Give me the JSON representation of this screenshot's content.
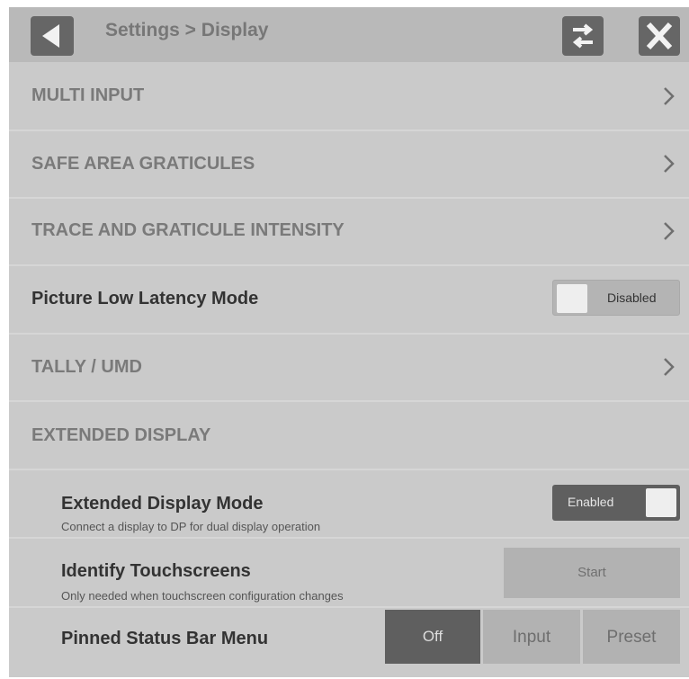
{
  "header": {
    "title": "Settings > Display",
    "back_icon": "back-arrow-icon",
    "swap_icon": "swap-arrows-icon",
    "close_icon": "close-x-icon"
  },
  "menu": {
    "multi_input": "MULTI INPUT",
    "safe_area": "SAFE AREA GRATICULES",
    "trace_intensity": "TRACE AND GRATICULE INTENSITY",
    "picture_low_latency": {
      "label": "Picture Low Latency Mode",
      "state": "Disabled"
    },
    "tally_umd": "TALLY / UMD",
    "extended_display": "EXTENDED DISPLAY"
  },
  "extended": {
    "mode": {
      "title": "Extended Display Mode",
      "description": "Connect a display to DP for dual display operation",
      "state": "Enabled"
    },
    "identify": {
      "title": "Identify Touchscreens",
      "description": "Only needed when touchscreen configuration changes",
      "button": "Start"
    },
    "pinned": {
      "title": "Pinned Status Bar Menu",
      "options": [
        "Off",
        "Input",
        "Preset"
      ],
      "selected": "Off"
    }
  },
  "colors": {
    "panel_bg": "#c9c9c9",
    "header_bg": "#b9b9b9",
    "button_dark": "#666666",
    "selected_segment": "#5f5f5f"
  }
}
